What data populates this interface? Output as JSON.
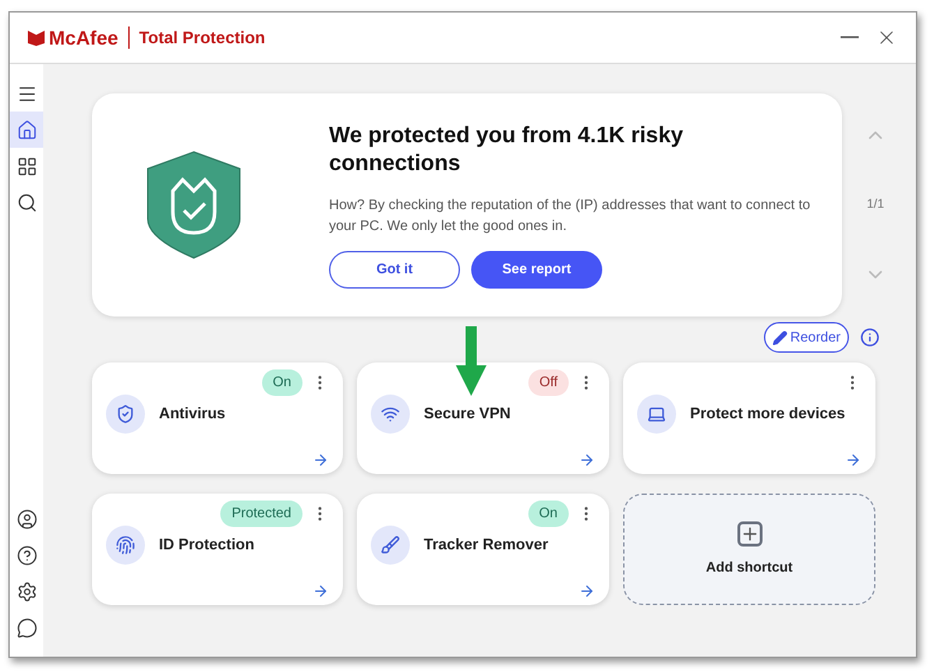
{
  "window": {
    "brand": "McAfee",
    "title": "Total Protection"
  },
  "sidebar": {
    "top_items": [
      {
        "selected": false
      },
      {
        "selected": true
      },
      {
        "selected": false
      },
      {
        "selected": false
      }
    ],
    "bottom_items": [
      {
        "selected": false
      },
      {
        "selected": false
      },
      {
        "selected": false
      },
      {
        "selected": false
      }
    ]
  },
  "banner": {
    "title": "We protected you from 4.1K risky connections",
    "body": "How? By checking the reputation of the (IP) addresses that want to connect to your PC. We only let the good ones in.",
    "buttons": [
      {
        "label": "Got it",
        "kind": "outline"
      },
      {
        "label": "See report",
        "kind": "primary"
      }
    ],
    "pager": "1/1"
  },
  "reorder_button": "Reorder",
  "cards": [
    {
      "kind": "feature",
      "title": "Antivirus",
      "badge": {
        "text": "On",
        "kind": "good"
      }
    },
    {
      "kind": "feature",
      "title": "Secure VPN",
      "badge": {
        "text": "Off",
        "kind": "bad"
      }
    },
    {
      "kind": "feature",
      "title": "Protect more devices"
    },
    {
      "kind": "feature",
      "title": "ID Protection",
      "badge": {
        "text": "Protected",
        "kind": "good"
      }
    },
    {
      "kind": "feature",
      "title": "Tracker Remover",
      "badge": {
        "text": "On",
        "kind": "good"
      }
    },
    {
      "kind": "add",
      "title": "Add shortcut"
    }
  ]
}
